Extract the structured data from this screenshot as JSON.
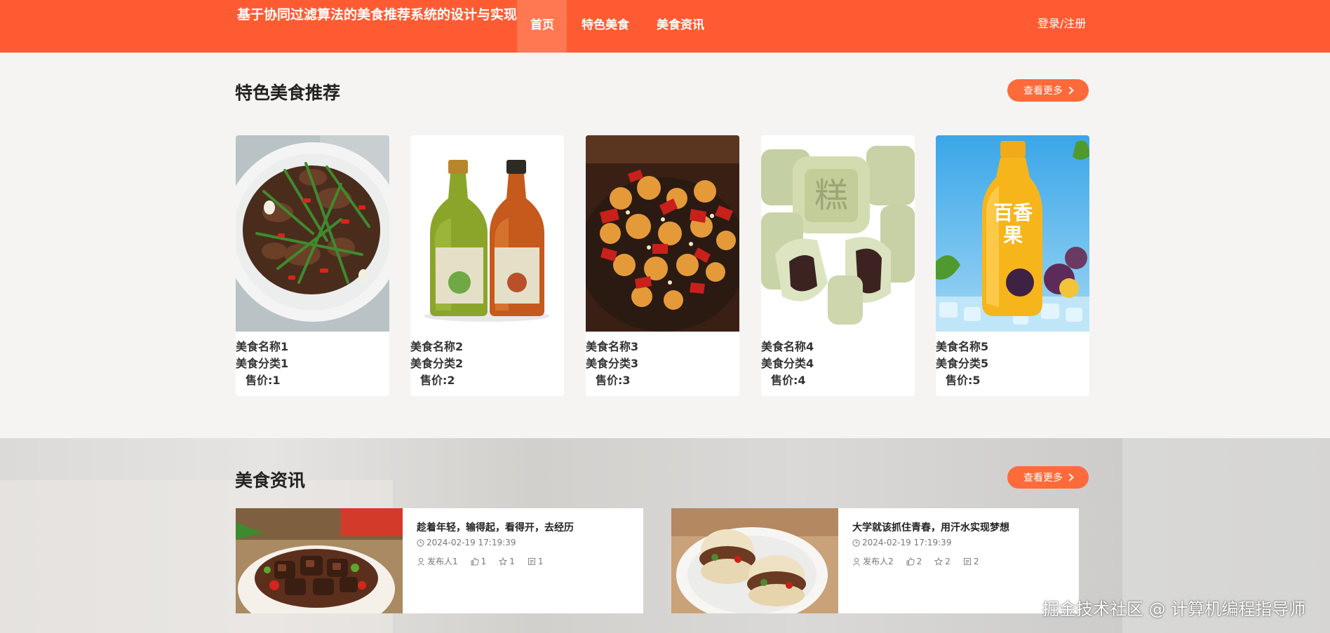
{
  "header": {
    "site_title": "基于协同过滤算法的美食推荐系统的设计与实现",
    "nav": [
      "首页",
      "特色美食",
      "美食资讯"
    ],
    "login": "登录/注册",
    "brand_color": "#ff5b32"
  },
  "featured": {
    "title": "特色美食推荐",
    "more": "查看更多",
    "items": [
      {
        "name": "美食名称1",
        "category": "美食分类1",
        "price": "售价:1",
        "image": "stir-fried-beef-celery"
      },
      {
        "name": "美食名称2",
        "category": "美食分类2",
        "price": "售价:2",
        "image": "organic-juice-bottles"
      },
      {
        "name": "美食名称3",
        "category": "美食分类3",
        "price": "售价:3",
        "image": "spicy-chicken-chili"
      },
      {
        "name": "美食名称4",
        "category": "美食分类4",
        "price": "售价:4",
        "image": "green-mung-bean-cakes"
      },
      {
        "name": "美食名称5",
        "category": "美食分类5",
        "price": "售价:5",
        "image": "passion-fruit-tea-bottle"
      }
    ]
  },
  "news": {
    "title": "美食资讯",
    "more": "查看更多",
    "items": [
      {
        "title": "趁着年轻，输得起，看得开，去经历",
        "date": "2024-02-19 17:19:39",
        "author": "发布人1",
        "likes": "1",
        "favorites": "1",
        "comments": "1",
        "image": "braised-beef-claypot"
      },
      {
        "title": "大学就该抓住青春，用汗水实现梦想",
        "date": "2024-02-19 17:19:39",
        "author": "发布人2",
        "likes": "2",
        "favorites": "2",
        "comments": "2",
        "image": "chinese-burger-roujiamo"
      }
    ]
  },
  "watermark": "掘金技术社区 @ 计算机编程指导师"
}
